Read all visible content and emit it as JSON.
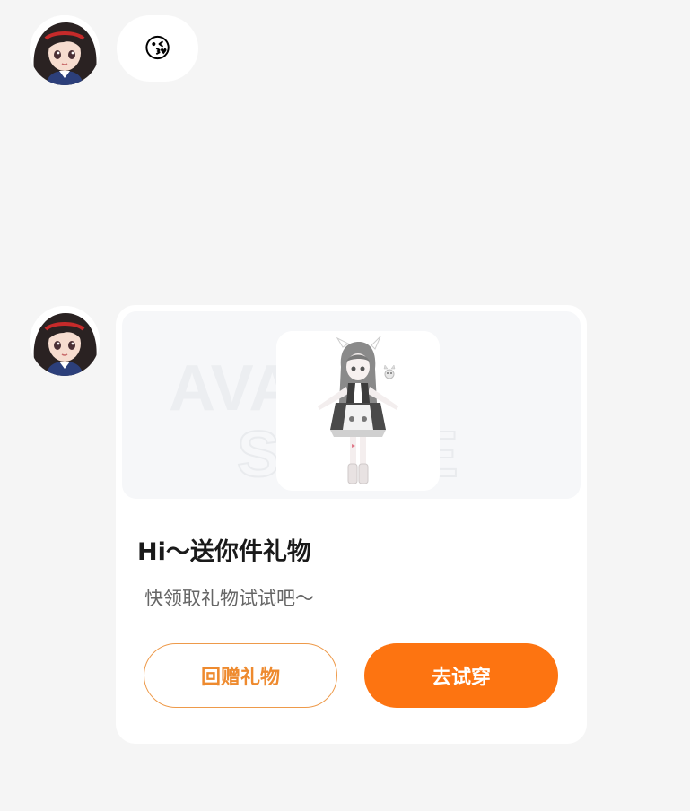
{
  "messages": [
    {
      "type": "emoji",
      "emoji": "😘"
    },
    {
      "type": "gift_card",
      "banner_watermark": [
        "AVATAR",
        "STORE"
      ],
      "title": "Hi～送你件礼物",
      "subtitle": "快领取礼物试试吧～",
      "return_gift_label": "回赠礼物",
      "try_on_label": "去试穿"
    }
  ],
  "colors": {
    "accent": "#fd7411",
    "outline_button": "#ee8a2e",
    "background": "#f5f5f5"
  }
}
